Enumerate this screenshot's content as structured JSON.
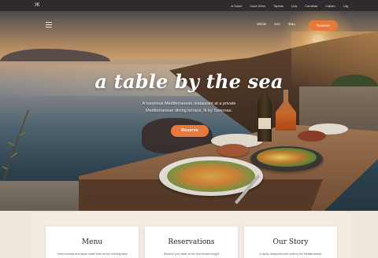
{
  "topnav": {
    "logo_label": "Ж",
    "links": [
      "A Home",
      "Cave Wine",
      "Tapeas",
      "Lios",
      "Cametas",
      "Callam",
      "Lilg"
    ]
  },
  "subnav": {
    "links": [
      "Wildie",
      "Ime",
      "Wau"
    ],
    "reserve_label": "Reserve"
  },
  "hero": {
    "title": "a table by the sea",
    "subtitle_line1": "A luxurious Mediterranean restaurant at a private",
    "subtitle_line2": "Mediterranean dining terrace, lit by Tavernas.",
    "cta_label": "Reserve"
  },
  "cards": [
    {
      "title": "Menu",
      "text": "Three courses and tapas made fresh for the evening table"
    },
    {
      "title": "Reservations",
      "text": "Reserve your table on the sea terrace tonight"
    },
    {
      "title": "Our Story",
      "text": "A family restaurant with roots by the Mediterranean"
    }
  ],
  "colors": {
    "accent": "#e8793a",
    "topbar": "#2d2a2c",
    "card_bg": "#ffffff",
    "band_bg": "#f3ece2"
  },
  "icons": {
    "logo": "logo-icon",
    "menu": "hamburger-icon"
  }
}
